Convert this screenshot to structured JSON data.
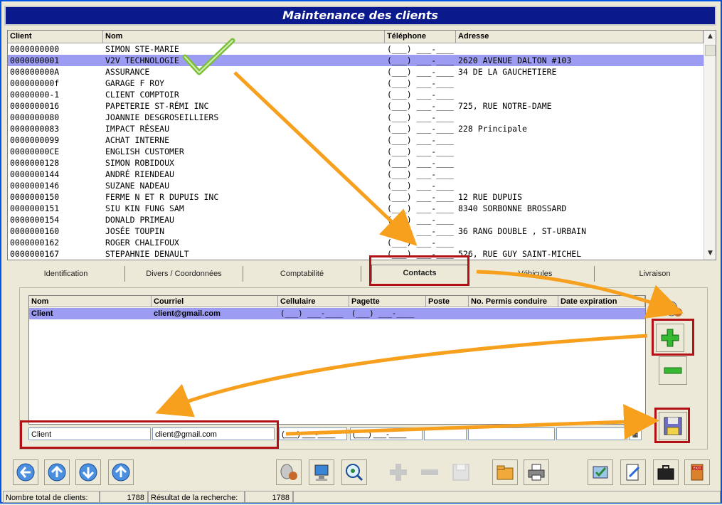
{
  "window": {
    "title": "Maintenance des clients"
  },
  "clients_grid": {
    "columns": [
      "Client",
      "Nom",
      "Téléphone",
      "Adresse"
    ],
    "rows": [
      [
        "0000000000",
        "SIMON STE-MARIE",
        "(___) ___-____",
        ""
      ],
      [
        "0000000001",
        "V2V TECHNOLOGIE",
        "(___) ___-____",
        "2620 AVENUE DALTON #103"
      ],
      [
        "000000000A",
        "ASSURANCE",
        "(___) ___-____",
        "34 DE LA GAUCHETIERE"
      ],
      [
        "000000000f",
        "GARAGE F ROY",
        "(___) ___-____",
        ""
      ],
      [
        "00000000-1",
        "CLIENT COMPTOIR",
        "(___) ___-____",
        ""
      ],
      [
        "0000000016",
        "PAPETERIE ST-RÉMI INC",
        "(___) ___-____",
        "725, RUE NOTRE-DAME"
      ],
      [
        "0000000080",
        "JOANNIE DESGROSEILLIERS",
        "(___) ___-____",
        ""
      ],
      [
        "0000000083",
        "IMPACT RÉSEAU",
        "(___) ___-____",
        "228 Principale"
      ],
      [
        "0000000099",
        "ACHAT INTERNE",
        "(___) ___-____",
        ""
      ],
      [
        "00000000CE",
        "ENGLISH CUSTOMER",
        "(___) ___-____",
        ""
      ],
      [
        "0000000128",
        "SIMON ROBIDOUX",
        "(___) ___-____",
        ""
      ],
      [
        "0000000144",
        "ANDRÉ RIENDEAU",
        "(___) ___-____",
        ""
      ],
      [
        "0000000146",
        "SUZANE NADEAU",
        "(___) ___-____",
        ""
      ],
      [
        "0000000150",
        "FERME N ET R DUPUIS INC",
        "(___) ___-____",
        "12 RUE DUPUIS"
      ],
      [
        "0000000151",
        "SIU KIN FUNG SAM",
        "(___) ___-____",
        "8340 SORBONNE BROSSARD"
      ],
      [
        "0000000154",
        "DONALD PRIMEAU",
        "(___) ___-____",
        ""
      ],
      [
        "0000000160",
        "JOSÉE TOUPIN",
        "(___) ___-____",
        "36 RANG DOUBLE , ST-URBAIN"
      ],
      [
        "0000000162",
        "ROGER CHALIFOUX",
        "(___) ___-____",
        ""
      ],
      [
        "0000000167",
        "STEPAHNIE DENAULT",
        "(___) ___-____",
        "526, RUE GUY SAINT-MICHEL"
      ]
    ],
    "selected_row": 1
  },
  "tabs": [
    {
      "label": "Identification"
    },
    {
      "label": "Divers / Coordonnées"
    },
    {
      "label": "Comptabilité"
    },
    {
      "label": "Contacts"
    },
    {
      "label": "Véhicules"
    },
    {
      "label": "Livraison"
    }
  ],
  "active_tab": "Contacts",
  "contacts_grid": {
    "columns": [
      "Nom",
      "Courriel",
      "Cellulaire",
      "Pagette",
      "Poste",
      "No. Permis conduire",
      "Date expiration"
    ],
    "rows": [
      {
        "nom": "Client",
        "courriel": "client@gmail.com",
        "cellulaire": "(___) ___-____",
        "pagette": "(___) ___-____",
        "poste": "",
        "permis": "",
        "expiration": ""
      }
    ]
  },
  "contact_edit": {
    "nom": "Client",
    "courriel": "client@gmail.com",
    "cellulaire": "(___) ___-____",
    "pagette": "(___) ___-____",
    "poste": "",
    "permis": "",
    "expiration": ""
  },
  "status": {
    "total_label": "Nombre total de clients:",
    "total_value": "1788",
    "result_label": "Résultat de la recherche:",
    "result_value": "1788"
  },
  "colors": {
    "title_bg": "#0a1a8c",
    "selection": "#9c9cf2",
    "highlight_box": "#b30f14",
    "arrow": "#f7a01d",
    "check": "#7bbf3a"
  },
  "icons": {
    "check": "check-mark-icon",
    "contact_tool": "contact-tool-icon",
    "add": "plus-icon",
    "remove": "minus-icon",
    "save": "floppy-disk-icon",
    "exit": "exit-door-icon"
  }
}
